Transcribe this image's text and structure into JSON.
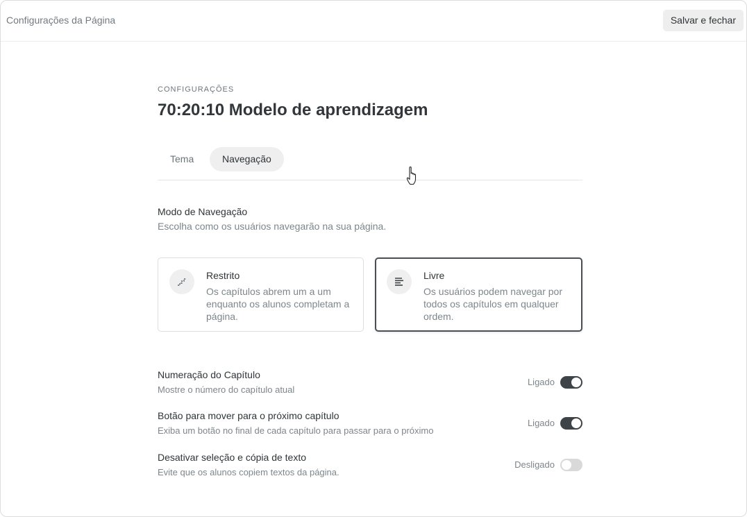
{
  "header": {
    "title": "Configurações da Página",
    "save_label": "Salvar e fechar"
  },
  "page": {
    "eyebrow": "CONFIGURAÇÕES",
    "heading": "70:20:10 Modelo de aprendizagem"
  },
  "tabs": [
    {
      "label": "Tema",
      "active": false
    },
    {
      "label": "Navegação",
      "active": true
    }
  ],
  "navigation_mode": {
    "title": "Modo de Navegação",
    "subtitle": "Escolha como os usuários navegarão na sua página.",
    "options": [
      {
        "title": "Restrito",
        "description": "Os capítulos abrem um a um enquanto os alunos completam a página.",
        "icon": "stairs-icon",
        "selected": false
      },
      {
        "title": "Livre",
        "description": "Os usuários podem navegar por todos os capítulos em qualquer ordem.",
        "icon": "align-left-icon",
        "selected": true
      }
    ]
  },
  "settings": [
    {
      "title": "Numeração do Capítulo",
      "subtitle": "Mostre o número do capítulo atual",
      "state": "Ligado",
      "on": true
    },
    {
      "title": "Botão para mover para o próximo capítulo",
      "subtitle": "Exiba um botão no final de cada capítulo para passar para o próximo",
      "state": "Ligado",
      "on": true
    },
    {
      "title": "Desativar seleção e cópia de texto",
      "subtitle": "Evite que os alunos copiem textos da página.",
      "state": "Desligado",
      "on": false
    }
  ],
  "colors": {
    "toggle_on": "#3e4347",
    "toggle_off": "#d9d9d9",
    "selected_border": "#4a4f53"
  }
}
